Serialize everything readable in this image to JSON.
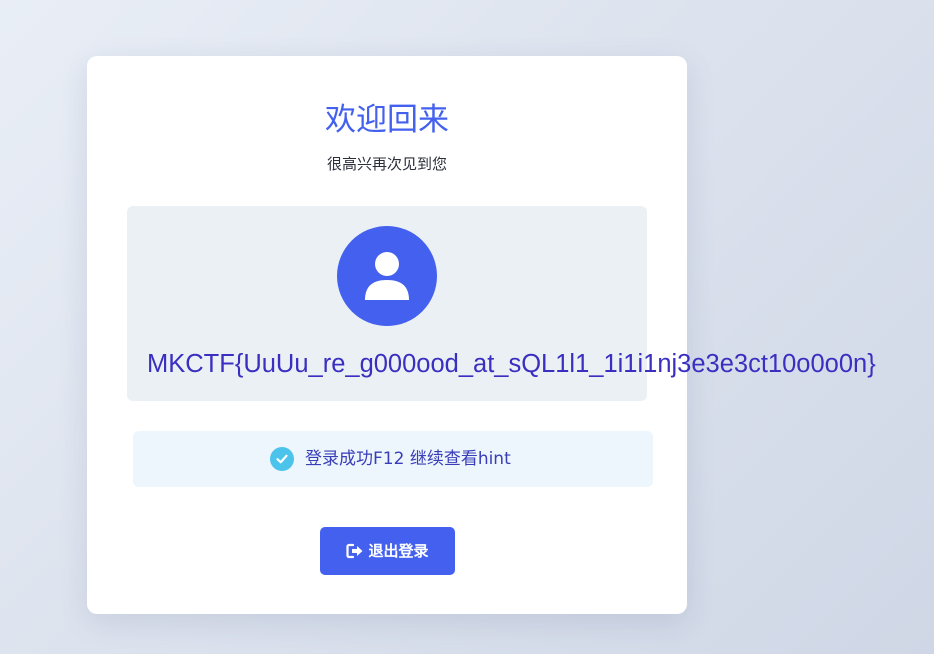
{
  "welcome": {
    "title": "欢迎回来",
    "subtitle": "很高兴再次见到您"
  },
  "profile": {
    "avatar_icon": "user-icon",
    "flag_text": "MKCTF{UuUu_re_g000ood_at_sQL1l1_1i1i1nj3e3e3ct10o0o0n}"
  },
  "alert": {
    "icon": "check-circle-icon",
    "message": "登录成功F12 继续查看hint"
  },
  "logout": {
    "icon": "sign-out-icon",
    "label": "退出登录"
  },
  "colors": {
    "primary": "#4361ee",
    "flag_text": "#3a2fc0",
    "alert_bg": "#ecf6fc",
    "alert_icon": "#4cc3ea",
    "profile_bg": "#ebf0f4"
  }
}
